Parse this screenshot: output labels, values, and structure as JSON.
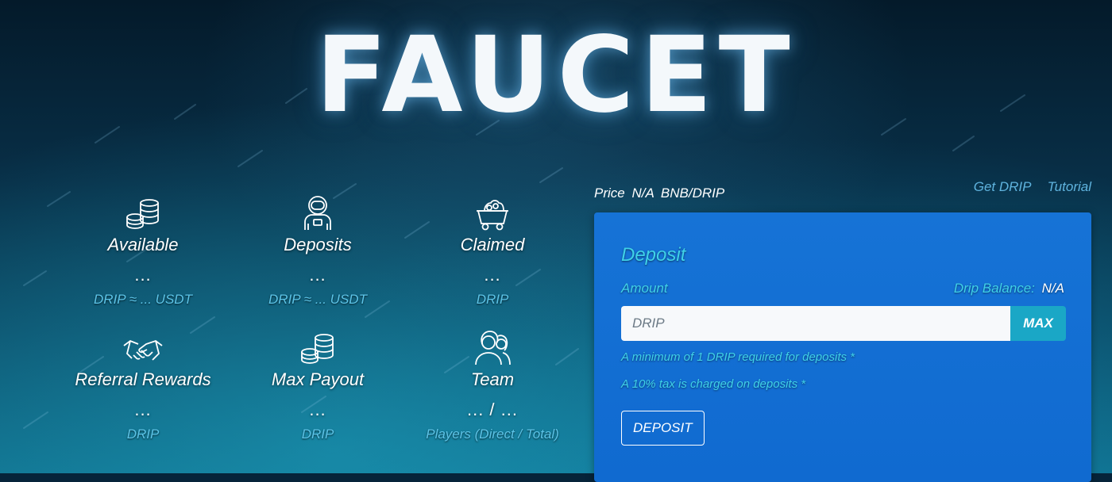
{
  "page": {
    "title": "FAUCET"
  },
  "stats": [
    {
      "icon": "coins-icon",
      "label": "Available",
      "value": "...",
      "unit": "DRIP ≈ ... USDT"
    },
    {
      "icon": "astronaut-icon",
      "label": "Deposits",
      "value": "...",
      "unit": "DRIP ≈ ... USDT"
    },
    {
      "icon": "mine-cart-icon",
      "label": "Claimed",
      "value": "...",
      "unit": "DRIP"
    },
    {
      "icon": "handshake-icon",
      "label": "Referral Rewards",
      "value": "...",
      "unit": "DRIP"
    },
    {
      "icon": "coins-icon",
      "label": "Max Payout",
      "value": "...",
      "unit": "DRIP"
    },
    {
      "icon": "team-icon",
      "label": "Team",
      "value": "... / ...",
      "unit": "Players (Direct / Total)"
    }
  ],
  "price": {
    "label": "Price",
    "value": "N/A",
    "unit": "BNB/DRIP"
  },
  "links": {
    "get_drip": "Get DRIP",
    "tutorial": "Tutorial"
  },
  "deposit_panel": {
    "heading": "Deposit",
    "amount_label": "Amount",
    "balance_label": "Drip Balance:",
    "balance_value": "N/A",
    "input_placeholder": "DRIP",
    "max_label": "MAX",
    "note_minimum": "A minimum of 1 DRIP required for deposits *",
    "note_tax": "A 10% tax is charged on deposits *",
    "deposit_label": "DEPOSIT"
  },
  "colors": {
    "panel_blue": "#1673d6",
    "accent_cyan": "#3fd1e8",
    "link_blue": "#5fb3de",
    "max_button": "#1aa7c6"
  }
}
